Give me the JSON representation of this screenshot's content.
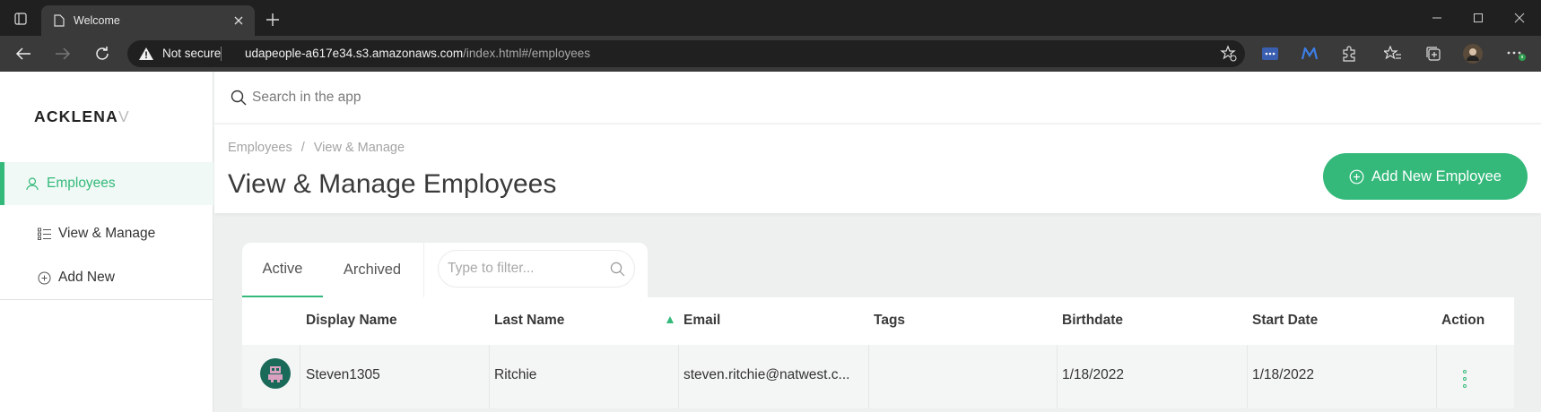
{
  "browser": {
    "tab_title": "Welcome",
    "security_label": "Not secure",
    "url_host": "udapeople-a617e34.s3.amazonaws.com",
    "url_path": "/index.html#/employees"
  },
  "sidebar": {
    "logo_main": "ACKLENA",
    "logo_fade": "V",
    "items": [
      {
        "label": "Employees",
        "icon": "user-icon",
        "active": true
      },
      {
        "label": "View & Manage",
        "icon": "list-icon",
        "active": false
      },
      {
        "label": "Add New",
        "icon": "plus-circle-icon",
        "active": false
      }
    ]
  },
  "topbar": {
    "search_placeholder": "Search in the app"
  },
  "header": {
    "breadcrumb": [
      "Employees",
      "View & Manage"
    ],
    "title": "View & Manage Employees",
    "add_button_label": "Add New Employee"
  },
  "panel": {
    "tabs": [
      "Active",
      "Archived"
    ],
    "filter_placeholder": "Type to filter..."
  },
  "table": {
    "columns": [
      "Display Name",
      "Last Name",
      "Email",
      "Tags",
      "Birthdate",
      "Start Date",
      "Action"
    ],
    "sorted_column": "Email",
    "rows": [
      {
        "display_name": "Steven1305",
        "last_name": "Ritchie",
        "email": "steven.ritchie@natwest.c...",
        "tags": "",
        "birthdate": "1/18/2022",
        "start_date": "1/18/2022"
      }
    ]
  },
  "colors": {
    "accent": "#34b97b",
    "chrome_dark": "#202020",
    "chrome_toolbar": "#3a3a3a"
  }
}
